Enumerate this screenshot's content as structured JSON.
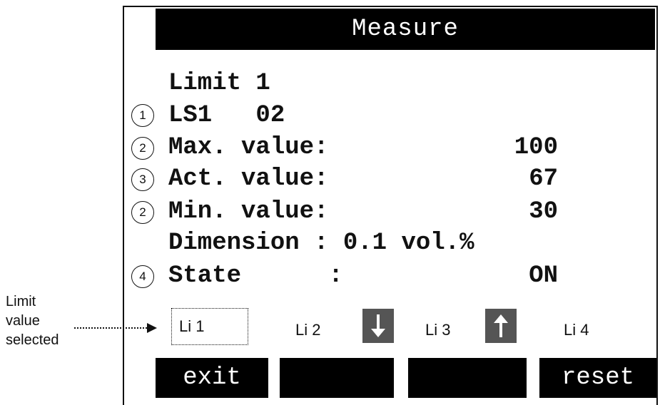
{
  "screen": {
    "title": "Measure",
    "heading": "Limit 1",
    "rows": [
      {
        "marker": "1",
        "label": "LS1   02",
        "value": ""
      },
      {
        "marker": "2",
        "label": "Max. value:",
        "value": "100"
      },
      {
        "marker": "3",
        "label": "Act. value:",
        "value": "67"
      },
      {
        "marker": "2",
        "label": "Min. value:",
        "value": "30"
      },
      {
        "marker": "",
        "label": "Dimension : 0.1 vol.%",
        "value": ""
      },
      {
        "marker": "4",
        "label": "State      :",
        "value": "ON"
      }
    ],
    "tabs": {
      "li1": "Li 1",
      "li2": "Li 2",
      "li3": "Li 3",
      "li4": "Li 4"
    },
    "softkeys": {
      "exit": "exit",
      "blank1": "",
      "blank2": "",
      "reset": "reset"
    }
  },
  "callout": {
    "line1": "Limit",
    "line2": "value",
    "line3": "selected"
  },
  "icons": {
    "down": "arrow-down-icon",
    "up": "arrow-up-icon"
  },
  "colors": {
    "bar": "#000000",
    "arrow_box": "#555555",
    "text": "#111111",
    "background": "#ffffff"
  }
}
